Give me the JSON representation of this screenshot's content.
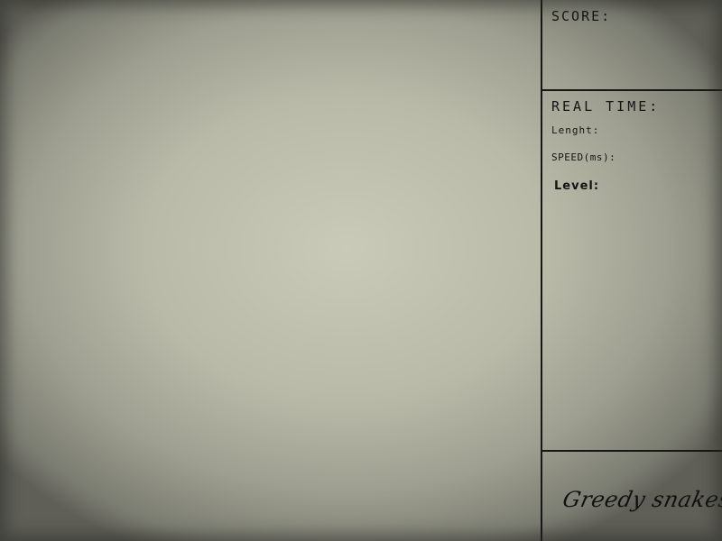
{
  "side_panel": {
    "score_label": "SCORE:",
    "realtime_title": "REAL TIME:",
    "length_label": "Lenght:",
    "speed_label": "SPEED(ms):",
    "level_label": "Level:",
    "brand": "Greedy snakes"
  },
  "colors": {
    "board_center": "#c9cab7",
    "board_edge": "#5f5f58",
    "divider": "#161616",
    "text": "#151515"
  }
}
